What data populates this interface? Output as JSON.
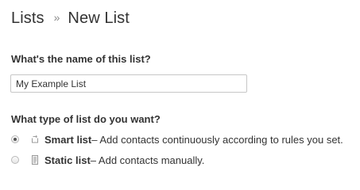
{
  "breadcrumb": {
    "parent": "Lists",
    "separator": "»",
    "current": "New List"
  },
  "name_section": {
    "title": "What's the name of this list?",
    "input_value": "My Example List"
  },
  "type_section": {
    "title": "What type of list do you want?",
    "options": [
      {
        "name": "Smart list",
        "description": " – Add contacts continuously according to rules you set.",
        "selected": true,
        "icon": "smart-list-icon"
      },
      {
        "name": "Static list",
        "description": " – Add contacts manually.",
        "selected": false,
        "icon": "static-list-icon"
      }
    ]
  },
  "colors": {
    "text": "#333333",
    "separator": "#8a8a8a",
    "input_border": "#c7c7c7",
    "icon": "#9a9a9a"
  }
}
